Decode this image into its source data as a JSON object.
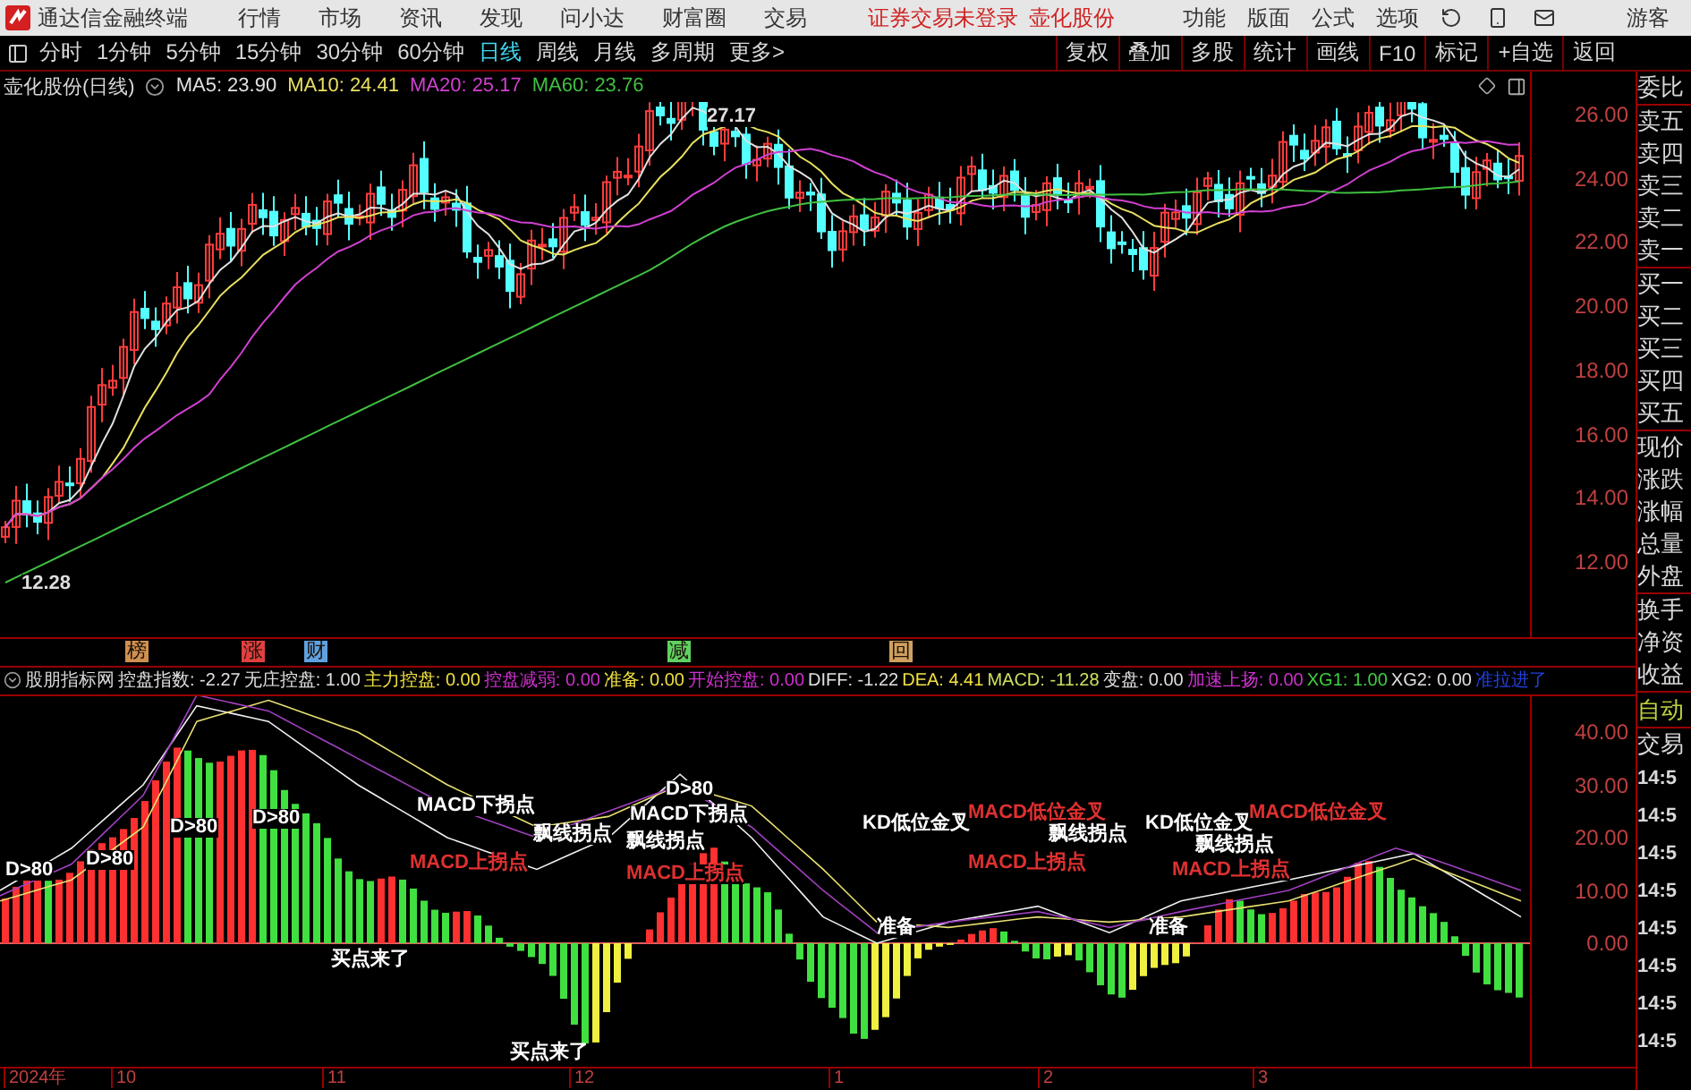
{
  "title_bar": {
    "app_name": "通达信金融终端",
    "menus": [
      "行情",
      "市场",
      "资讯",
      "发现",
      "问小达",
      "财富圈",
      "交易"
    ],
    "status": "证券交易未登录",
    "stock": "壶化股份",
    "tools": [
      "功能",
      "版面",
      "公式",
      "选项"
    ],
    "user": "游客"
  },
  "toolbar": {
    "periods": [
      {
        "label": "分时",
        "selected": false
      },
      {
        "label": "1分钟",
        "selected": false
      },
      {
        "label": "5分钟",
        "selected": false
      },
      {
        "label": "15分钟",
        "selected": false
      },
      {
        "label": "30分钟",
        "selected": false
      },
      {
        "label": "60分钟",
        "selected": false
      },
      {
        "label": "日线",
        "selected": true
      },
      {
        "label": "周线",
        "selected": false
      },
      {
        "label": "月线",
        "selected": false
      },
      {
        "label": "多周期",
        "selected": false
      },
      {
        "label": "更多>",
        "selected": false
      }
    ],
    "actions": [
      "复权",
      "叠加",
      "多股",
      "统计",
      "画线",
      "F10",
      "标记",
      "+自选",
      "返回"
    ]
  },
  "price_chart": {
    "title": "壶化股份(日线)",
    "moving_averages": [
      {
        "label": "MA5: 23.90",
        "color": "#e0e0e0"
      },
      {
        "label": "MA10: 24.41",
        "color": "#e8e060"
      },
      {
        "label": "MA20: 25.17",
        "color": "#d040d0"
      },
      {
        "label": "MA60: 23.76",
        "color": "#40c040"
      }
    ],
    "high_label": "27.17",
    "low_label": "12.28",
    "axis_labels": [
      "26.00",
      "24.00",
      "22.00",
      "20.00",
      "18.00",
      "16.00",
      "14.00",
      "12.00"
    ]
  },
  "event_markers": [
    {
      "text": "榜",
      "color": "#d09050"
    },
    {
      "text": "涨",
      "color": "#e04040"
    },
    {
      "text": "财",
      "color": "#60a0e0"
    },
    {
      "text": "减",
      "color": "#60d060"
    },
    {
      "text": "回",
      "color": "#d0a060"
    }
  ],
  "indicator": {
    "name": "股朋指标网",
    "values": [
      "控盘指数: -2.27",
      "无庄控盘: 1.00",
      "主力控盘: 0.00",
      "控盘减弱: 0.00",
      "准备: 0.00",
      "开始控盘: 0.00",
      "DIFF: -1.22",
      "DEA: 4.41",
      "MACD: -11.28",
      "变盘: 0.00",
      "加速上扬: 0.00",
      "XG1: 1.00",
      "XG2: 0.00",
      "准拉进了"
    ],
    "signals": [
      "D>80",
      "D>80",
      "D>80",
      "D>80",
      "MACD下拐点",
      "MACD上拐点",
      "飘线拐点",
      "D>80",
      "MACD下拐点",
      "飘线拐点",
      "MACD上拐点",
      "KD低位金叉",
      "MACD低位金叉",
      "飘线拐点",
      "MACD上拐点",
      "KD低位金叉",
      "MACD低位金叉",
      "飘线拐点",
      "MACD上拐点",
      "准备",
      "准备",
      "买点来了",
      "买点来了"
    ],
    "axis_labels": [
      "40.00",
      "30.00",
      "20.00",
      "10.00",
      "0.00"
    ]
  },
  "date_axis": [
    "2024年",
    "10",
    "11",
    "12",
    "1",
    "2",
    "3"
  ],
  "quote_panel": {
    "groups": [
      [
        "委比"
      ],
      [
        "卖五",
        "卖四",
        "卖三",
        "卖二",
        "卖一"
      ],
      [
        "买一",
        "买二",
        "买三",
        "买四",
        "买五"
      ],
      [
        "现价",
        "涨跌",
        "涨幅",
        "总量",
        "外盘"
      ],
      [
        "换手",
        "净资",
        "收益"
      ]
    ],
    "auto": "自动",
    "trade": "交易",
    "times": [
      "14:5",
      "14:5",
      "14:5",
      "14:5",
      "14:5",
      "14:5",
      "14:5",
      "14:5"
    ]
  }
}
